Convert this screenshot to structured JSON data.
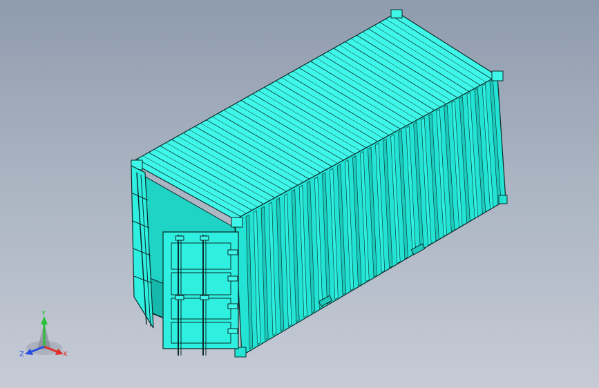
{
  "viewport": {
    "background_top": "#8f9cae",
    "background_bottom": "#c6cbd6"
  },
  "model": {
    "name": "shipping-container",
    "face_color": "#2ff0e0",
    "roof_color": "#3ff7e8",
    "edge_color": "#0b2a2a",
    "shadow_color": "#1cc9bb"
  },
  "triad": {
    "x_label": "X",
    "y_label": "Y",
    "z_label": "Z",
    "x_color": "#e0302a",
    "y_color": "#27c23a",
    "z_color": "#2a4ee0"
  }
}
